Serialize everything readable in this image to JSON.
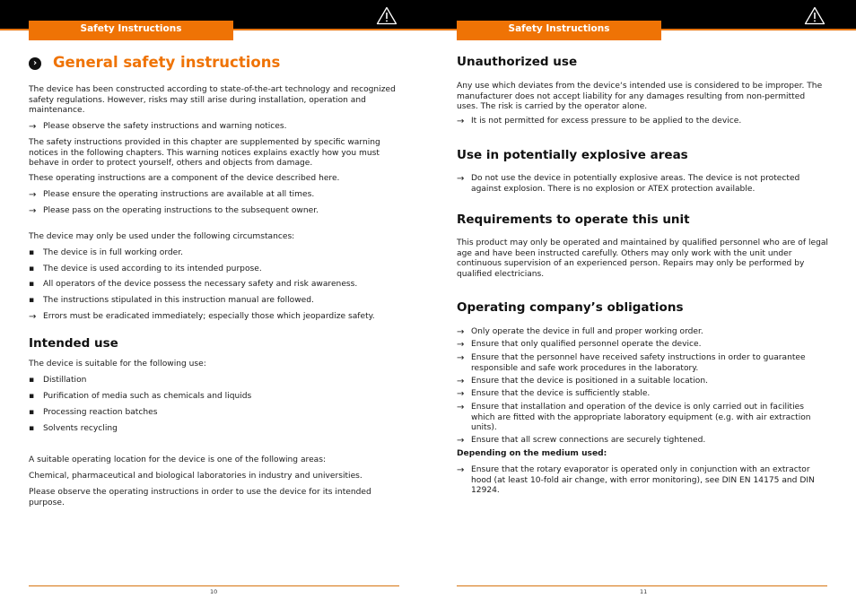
{
  "header": {
    "section_tab": "Safety Instructions",
    "warning_icon": "warning-triangle-icon",
    "accent_color": "#ef7305"
  },
  "left_page": {
    "title": "General safety instructions",
    "title_icon": "chevron-circle-icon",
    "intro": "The device has been constructed according to state-of-the-art technology and recognized safety regulations. However, risks may still arise during installation, operation and maintenance.",
    "arrow1": "Please observe the safety instructions and warning notices.",
    "para2": "The safety instructions provided in this chapter are supplemented by specific warning notices in the following chapters. This warning notices explains exactly how you must behave in order to protect yourself, others and objects from damage.",
    "para3": "These operating instructions are a component of the device described here.",
    "arrow2": "Please ensure the operating instructions are available at all times.",
    "arrow3": "Please pass on the operating instructions to the subsequent owner.",
    "circumstances_intro": "The device may only be used under the following circumstances:",
    "circumstances": [
      "The device is in full working order.",
      "The device is used according to its intended purpose.",
      "All operators of the device possess the necessary safety and risk awareness.",
      "The instructions stipulated in this instruction manual are followed."
    ],
    "arrow4": "Errors must be eradicated immediately; especially those which jeopardize safety.",
    "intended_use": {
      "heading": "Intended use",
      "intro": "The device is suitable for the following use:",
      "uses": [
        "Distillation",
        "Purification of media such as chemicals and liquids",
        "Processing reaction batches",
        "Solvents recycling"
      ],
      "location_intro": "A suitable operating location for the device is one of the following areas:",
      "locations": "Chemical, pharmaceutical and biological laboratories in industry and universities.",
      "closing": "Please observe the operating instructions in order to use the device for its intended purpose."
    },
    "page_number": "10"
  },
  "right_page": {
    "unauthorized": {
      "heading": "Unauthorized use",
      "text": "Any use which deviates from the device‘s intended use is considered to be improper. The manufacturer does not accept liability for any damages resulting from non-permitted uses. The risk is carried by the operator alone.",
      "arrow": "It is not permitted for excess pressure to be applied to the device."
    },
    "explosive": {
      "heading": "Use in potentially explosive areas",
      "arrow": "Do not use the device in potentially explosive areas. The device is not protected against explosion. There is no explosion or ATEX protection available."
    },
    "requirements": {
      "heading": "Requirements to operate this unit",
      "text": "This product may only be operated and maintained by qualified personnel who are of legal age and have been instructed carefully. Others may only work with the unit under continuous supervision of an experienced person. Repairs may only be performed by qualified electricians."
    },
    "obligations": {
      "heading": "Operating company’s obligations",
      "items": [
        "Only operate the device in full and proper working order.",
        "Ensure that only qualified personnel operate the device.",
        "Ensure that the personnel have received safety instructions in order to guarantee responsible and safe work procedures in the laboratory.",
        "Ensure that the device is positioned in a suitable location.",
        "Ensure that the device is sufficiently stable.",
        "Ensure that installation and operation of the device is only carried out in facilities which are fitted with the appropriate laboratory equipment (e.g. with air extraction units).",
        "Ensure that all screw connections are securely tightened."
      ],
      "medium_heading": "Depending on the medium used:",
      "medium_item": "Ensure that the rotary evaporator is operated only in conjunction with an extractor hood (at least 10-fold air change, with error monitoring), see DIN EN 14175 and DIN 12924."
    },
    "page_number": "11"
  }
}
